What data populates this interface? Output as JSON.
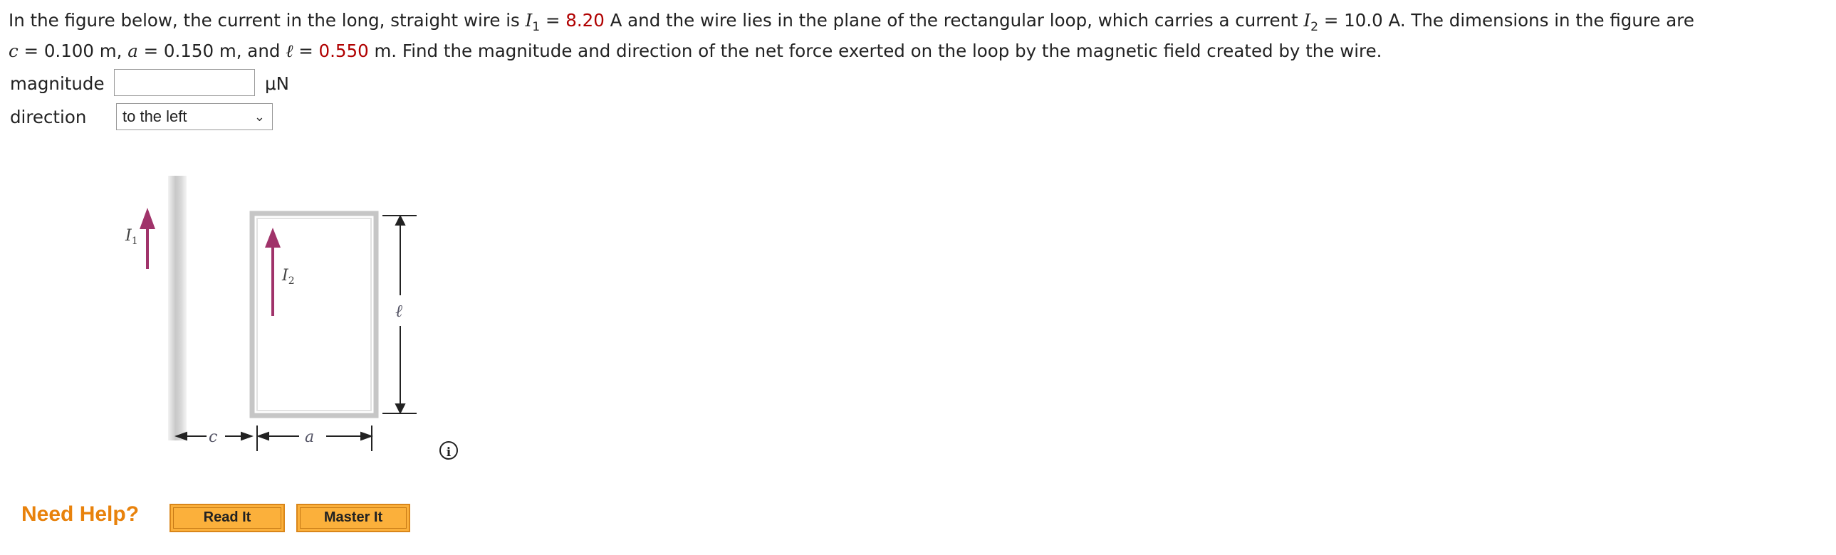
{
  "question": {
    "line1_a": "In the figure below, the current in the long, straight wire is ",
    "I1_sym": "I",
    "I1_sub": "1",
    "eq": " = ",
    "I1_value": "8.20",
    "line1_b": " A and the wire lies in the plane of the rectangular loop, which carries a current ",
    "I2_sym": "I",
    "I2_sub": "2",
    "I2_value": "10.0",
    "line1_c": " A. The dimensions in the figure are",
    "c_sym": "c",
    "c_value": " = 0.100 m, ",
    "a_sym": "a",
    "a_value": " = 0.150 m, and ",
    "l_sym": "ℓ",
    "l_value": "0.550",
    "line2_b": " m. Find the magnitude and direction of the net force exerted on the loop by the magnetic field created by the wire."
  },
  "answer": {
    "magnitude_label": "magnitude",
    "magnitude_value": "",
    "magnitude_unit": "μN",
    "direction_label": "direction",
    "direction_selected": "to the left"
  },
  "figure": {
    "I1": "I",
    "I1_sub": "1",
    "I2": "I",
    "I2_sub": "2",
    "ell": "ℓ",
    "c": "c",
    "a": "a",
    "arrow_color": "#a0336a"
  },
  "help": {
    "label": "Need Help?",
    "read_it": "Read It",
    "master_it": "Master It"
  }
}
